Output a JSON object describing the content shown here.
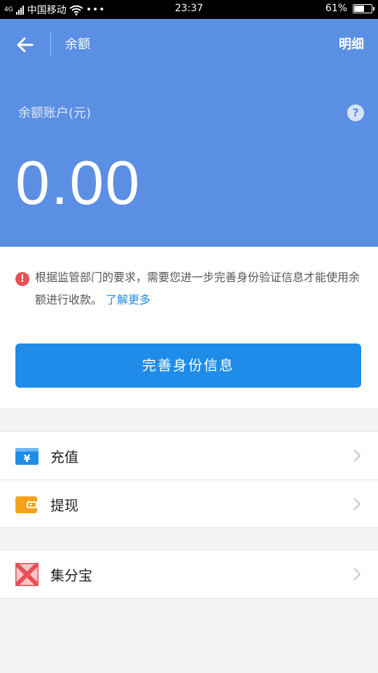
{
  "status_bar": {
    "signal": "4G",
    "carrier": "中国移动",
    "dots": "•••",
    "time": "23:37",
    "battery_text": "61%",
    "battery_level": 0.61
  },
  "header": {
    "title": "余额",
    "detail_link": "明细",
    "account_label": "余额账户(元)",
    "help_glyph": "?",
    "balance": "0.00",
    "background_color": "#5b8fe4"
  },
  "notice": {
    "icon_glyph": "!",
    "text": "根据监管部门的要求，需要您进一步完善身份验证信息才能使用余额进行收款。",
    "link": "了解更多",
    "button_label": "完善身份信息",
    "button_color": "#1f8ce9"
  },
  "menu_group_1": [
    {
      "label": "充值",
      "icon": "recharge-yuan-icon"
    },
    {
      "label": "提现",
      "icon": "wallet-icon"
    }
  ],
  "menu_group_2": [
    {
      "label": "集分宝",
      "icon": "jifenbao-icon"
    }
  ]
}
